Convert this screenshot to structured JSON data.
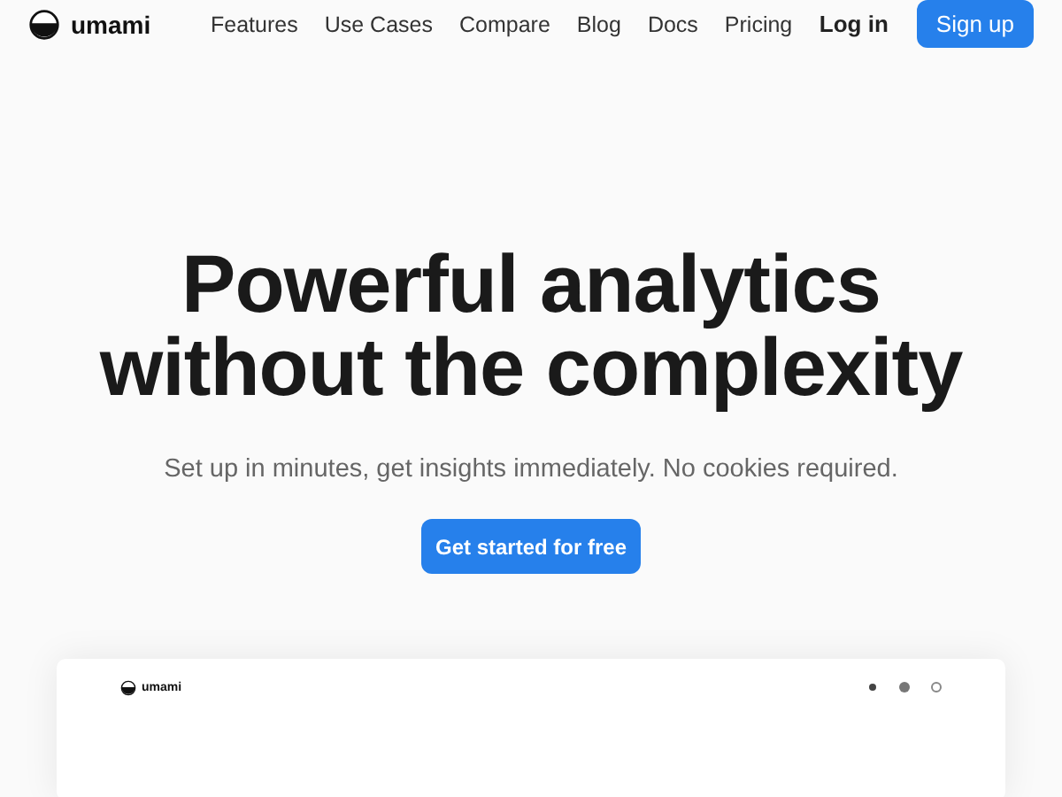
{
  "header": {
    "brand": "umami",
    "nav": [
      {
        "label": "Features"
      },
      {
        "label": "Use Cases"
      },
      {
        "label": "Compare"
      },
      {
        "label": "Blog"
      },
      {
        "label": "Docs"
      },
      {
        "label": "Pricing"
      }
    ],
    "login": "Log in",
    "signup": "Sign up"
  },
  "hero": {
    "title_lines": [
      "Powerful analytics",
      "without the complexity"
    ],
    "subtitle": "Set up in minutes, get insights immediately. No cookies required.",
    "cta": "Get started for free"
  },
  "preview": {
    "brand": "umami"
  }
}
